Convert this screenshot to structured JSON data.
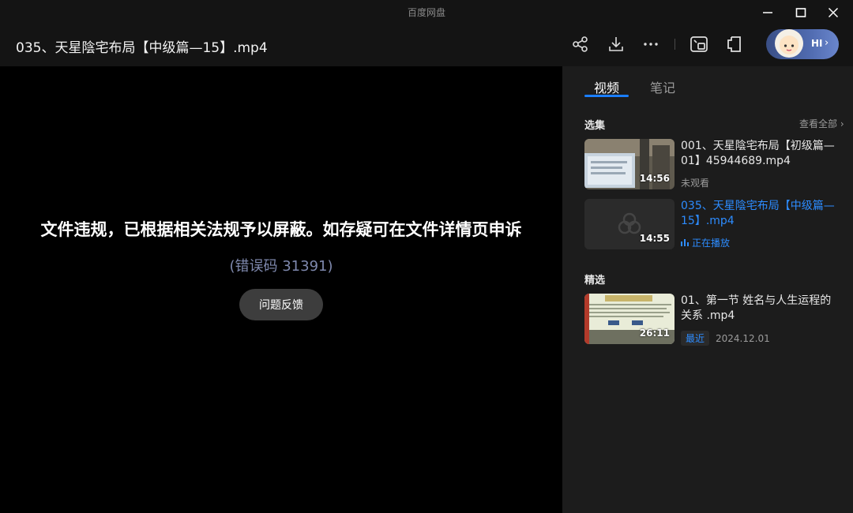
{
  "window": {
    "app_name": "百度网盘"
  },
  "header": {
    "file_title": "035、天星陰宅布局【中级篇—15】.mp4",
    "hi_label": "HI",
    "hi_chevron": "›"
  },
  "player": {
    "error_message": "文件违规，已根据相关法规予以屏蔽。如存疑可在文件详情页申诉",
    "error_code": "(错误码 31391)",
    "feedback_label": "问题反馈"
  },
  "side": {
    "tabs": [
      {
        "label": "视频",
        "active": true
      },
      {
        "label": "笔记",
        "active": false
      }
    ],
    "episodes": {
      "title": "选集",
      "view_all": "查看全部 ›",
      "items": [
        {
          "title": "001、天星陰宅布局【初级篇—01】45944689.mp4",
          "duration": "14:56",
          "status": "未观看"
        },
        {
          "title": "035、天星陰宅布局【中级篇—15】.mp4",
          "duration": "14:55",
          "status": "正在播放"
        }
      ]
    },
    "featured": {
      "title": "精选",
      "items": [
        {
          "title": "01、第一节 姓名与人生运程的关系 .mp4",
          "duration": "26:11",
          "badge": "最近",
          "date": "2024.12.01"
        }
      ]
    }
  },
  "colors": {
    "accent": "#2d8cff",
    "background": "#141414",
    "panel": "#1c1c1c"
  }
}
